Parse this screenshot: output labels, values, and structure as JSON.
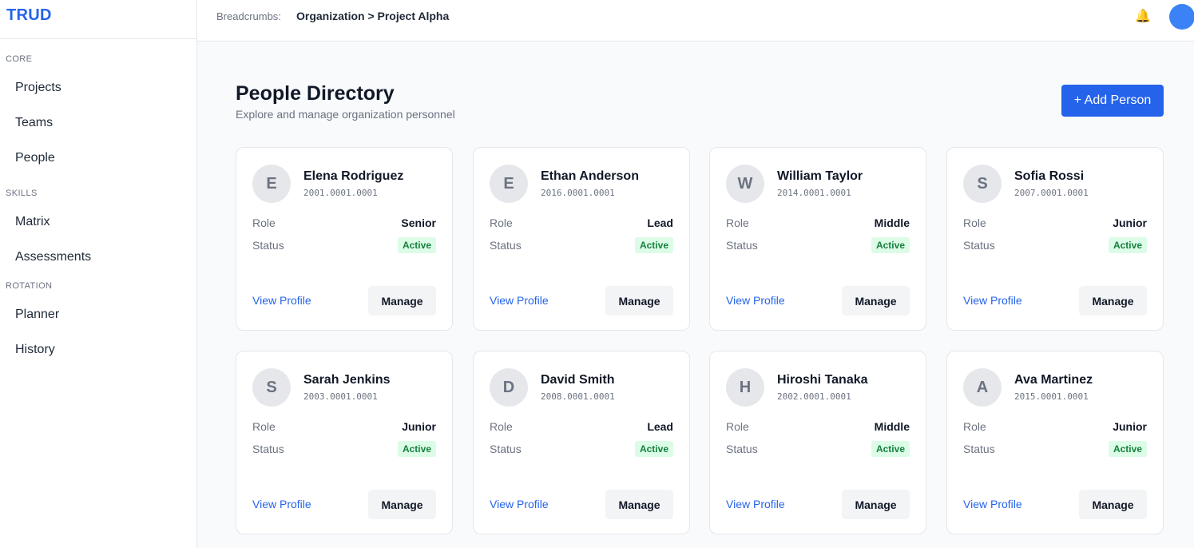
{
  "app": {
    "name": "TRUD"
  },
  "sidebar": {
    "sections": [
      {
        "label": "CORE",
        "items": [
          "Projects",
          "Teams",
          "People"
        ]
      },
      {
        "label": "SKILLS",
        "items": [
          "Matrix",
          "Assessments"
        ]
      },
      {
        "label": "ROTATION",
        "items": [
          "Planner",
          "History"
        ]
      }
    ]
  },
  "topbar": {
    "breadcrumb_label": "Breadcrumbs:",
    "breadcrumb_path": "Organization > Project Alpha",
    "notification_icon": "bell-icon"
  },
  "page": {
    "title": "People Directory",
    "subtitle": "Explore and manage organization personnel",
    "add_button": "+ Add Person"
  },
  "card_labels": {
    "role": "Role",
    "status": "Status",
    "view_profile": "View Profile",
    "manage": "Manage"
  },
  "people": [
    {
      "initial": "E",
      "name": "Elena Rodriguez",
      "id": "2001.0001.0001",
      "role": "Senior",
      "status": "Active"
    },
    {
      "initial": "E",
      "name": "Ethan Anderson",
      "id": "2016.0001.0001",
      "role": "Lead",
      "status": "Active"
    },
    {
      "initial": "W",
      "name": "William Taylor",
      "id": "2014.0001.0001",
      "role": "Middle",
      "status": "Active"
    },
    {
      "initial": "S",
      "name": "Sofia Rossi",
      "id": "2007.0001.0001",
      "role": "Junior",
      "status": "Active"
    },
    {
      "initial": "S",
      "name": "Sarah Jenkins",
      "id": "2003.0001.0001",
      "role": "Junior",
      "status": "Active"
    },
    {
      "initial": "D",
      "name": "David Smith",
      "id": "2008.0001.0001",
      "role": "Lead",
      "status": "Active"
    },
    {
      "initial": "H",
      "name": "Hiroshi Tanaka",
      "id": "2002.0001.0001",
      "role": "Middle",
      "status": "Active"
    },
    {
      "initial": "A",
      "name": "Ava Martinez",
      "id": "2015.0001.0001",
      "role": "Junior",
      "status": "Active"
    }
  ],
  "colors": {
    "accent": "#2563eb",
    "status_active_bg": "#dcfce7",
    "status_active_text": "#15803d"
  }
}
